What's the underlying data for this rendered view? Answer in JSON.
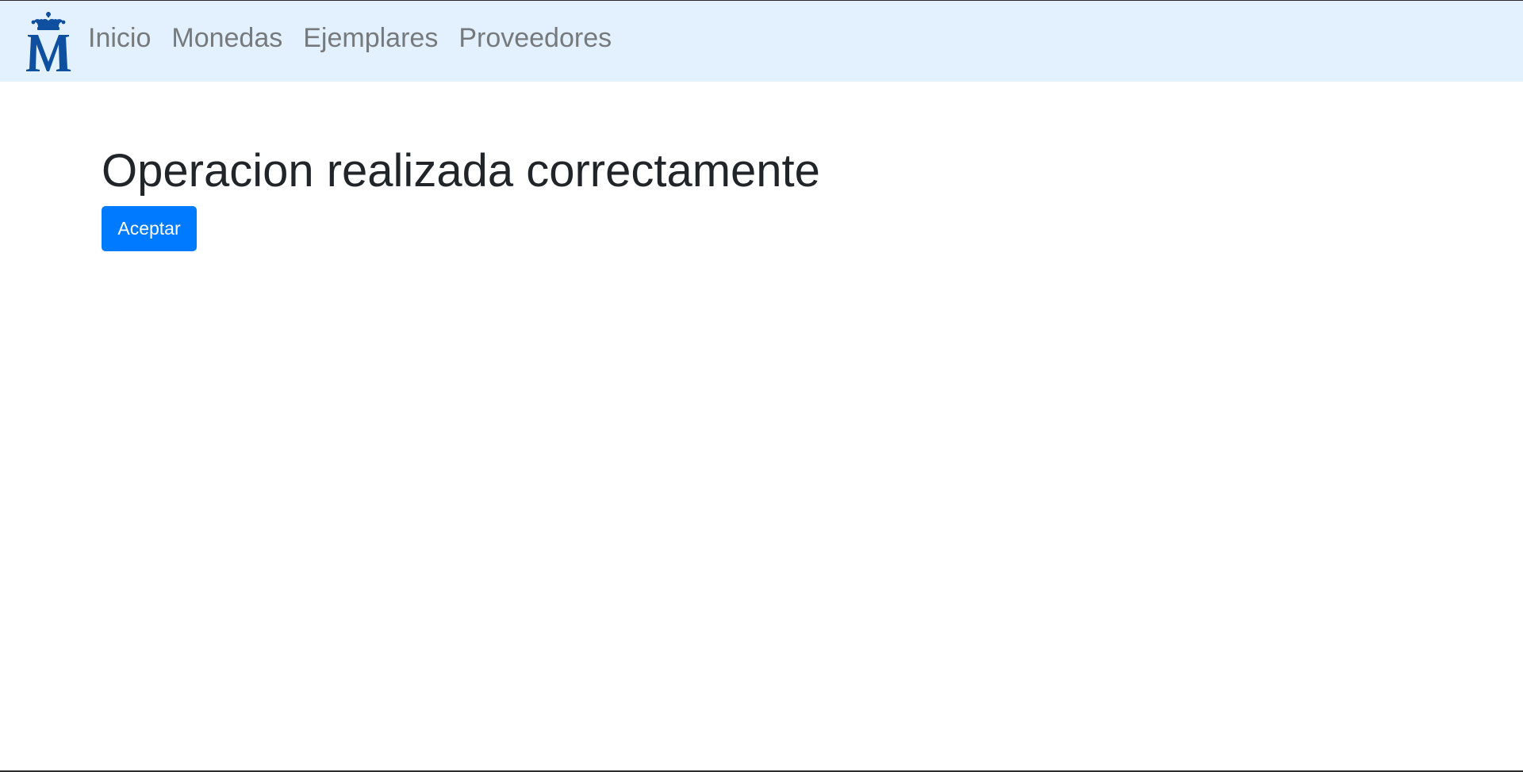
{
  "navbar": {
    "logo_icon": "crowned-m-monogram",
    "links": [
      {
        "label": "Inicio"
      },
      {
        "label": "Monedas"
      },
      {
        "label": "Ejemplares"
      },
      {
        "label": "Proveedores"
      }
    ]
  },
  "main": {
    "title": "Operacion realizada correctamente",
    "accept_label": "Aceptar"
  },
  "colors": {
    "navbar_background": "#e2f1fd",
    "nav_link": "#777a7d",
    "logo": "#0f4fa0",
    "title": "#212529",
    "button_primary": "#007bff"
  }
}
